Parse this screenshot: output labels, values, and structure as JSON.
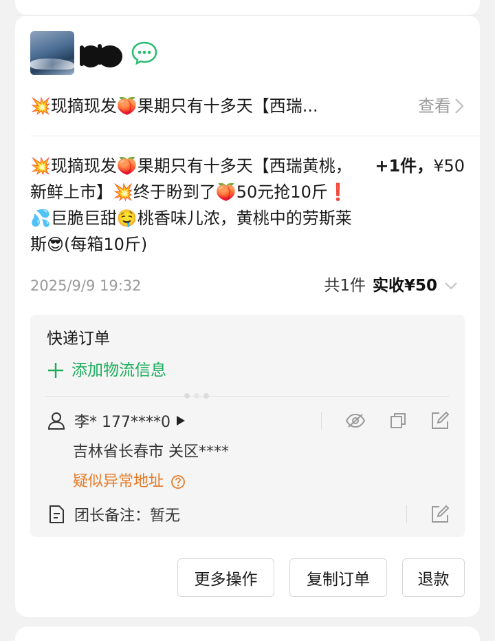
{
  "order": {
    "title_short": "💥现摘现发🍑果期只有十多天【西瑞...",
    "view_label": "查看",
    "product_desc": "💥现摘现发🍑果期只有十多天【西瑞黄桃，新鲜上市】💥终于盼到了🍑50元抢10斤❗💦巨脆巨甜🤤桃香味儿浓，黄桃中的劳斯莱斯😎(每箱10斤)",
    "qty_label": "+1件，",
    "unit_price": "¥50",
    "time": "2025/9/9 19:32",
    "total_count": "共1件",
    "paid_label": "实收¥50"
  },
  "panel": {
    "title": "快递订单",
    "add_logistics": "添加物流信息",
    "contact": "李* 177****0",
    "address": "吉林省长春市  关区****",
    "abnormal": "疑似异常地址",
    "note": "团长备注：暂无"
  },
  "actions": {
    "more": "更多操作",
    "copy": "复制订单",
    "refund": "退款"
  },
  "colors": {
    "accent_green": "#1aad5a",
    "warning_orange": "#e67a28",
    "wechat_green": "#2bbd6f"
  },
  "icons": [
    "wechat-icon",
    "chevron-right-icon",
    "chevron-down-icon",
    "plus-icon",
    "user-icon",
    "eye-off-icon",
    "copy-icon",
    "edit-icon",
    "document-icon",
    "question-icon"
  ]
}
